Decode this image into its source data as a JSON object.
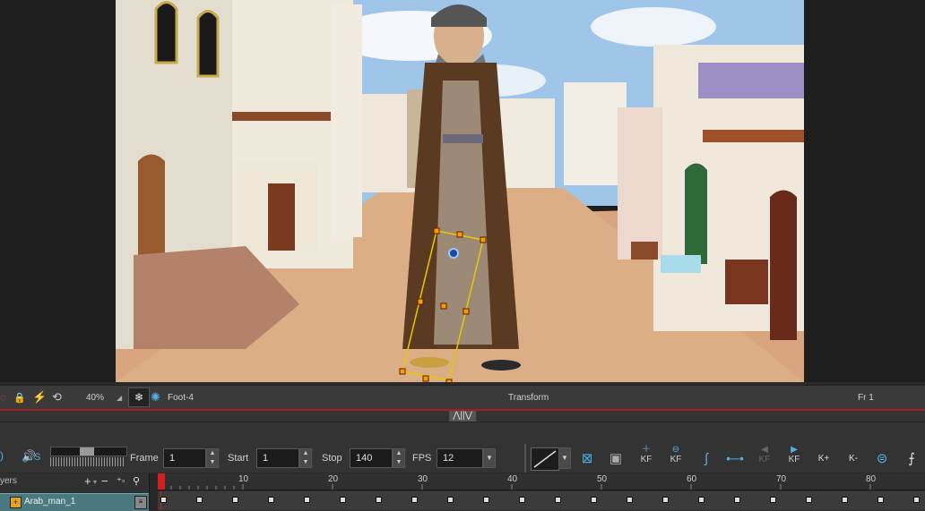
{
  "status": {
    "zoom": "40%",
    "node_name": "Foot-4",
    "tool_mode": "Transform",
    "frame_indicator": "Fr 1"
  },
  "toolbar": {
    "frame_label": "Frame",
    "frame_value": "1",
    "start_label": "Start",
    "start_value": "1",
    "stop_label": "Stop",
    "stop_value": "140",
    "fps_label": "FPS",
    "fps_value": "12",
    "sound_label": "S",
    "add_kf_label": "KF",
    "remove_kf_label": "KF",
    "next_kf_label": "KF",
    "prev_kf_label": "KF",
    "set_kf_label": "K+",
    "del_kf_label": "K-"
  },
  "timeline": {
    "layers_header": "yers",
    "layer_name": "Arab_man_1",
    "ruler_ticks": [
      "10",
      "20",
      "30",
      "40",
      "50",
      "60",
      "70",
      "80"
    ]
  },
  "colors": {
    "accent": "#4fb0e8",
    "playhead": "#d02020",
    "selection": "#e8c800"
  }
}
